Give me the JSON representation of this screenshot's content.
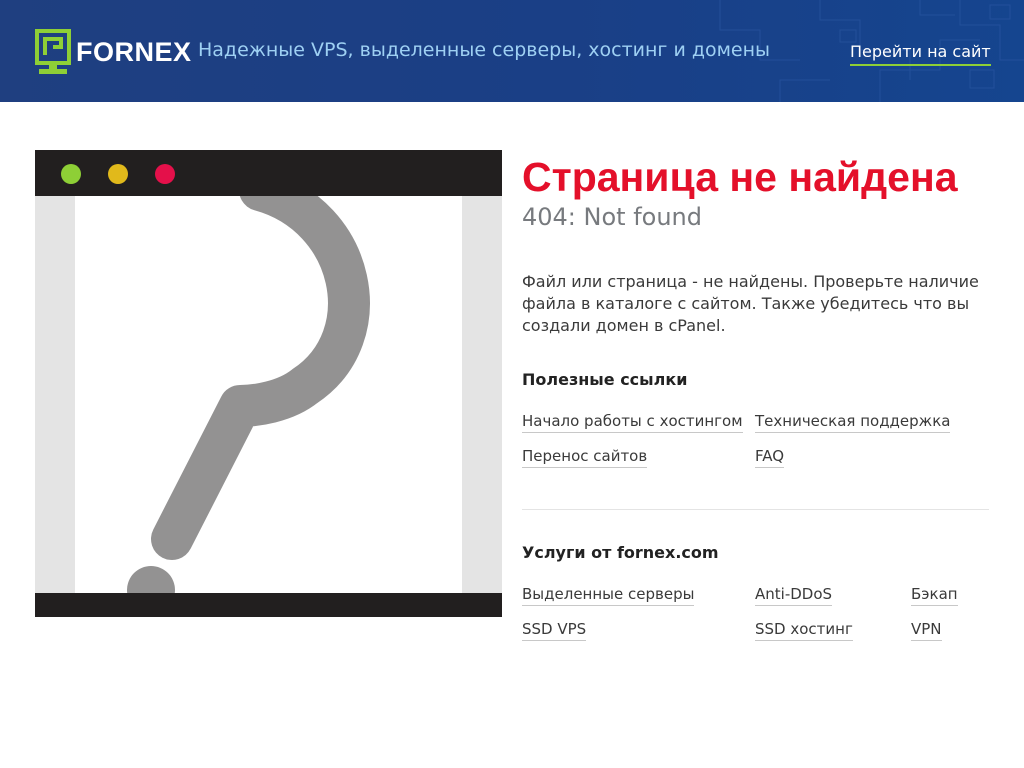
{
  "header": {
    "logo_text": "FORNEX",
    "tagline": "Надежные VPS, выделенные серверы, хостинг и домены",
    "goto_site": "Перейти на сайт"
  },
  "main": {
    "title": "Страница не найдена",
    "subtitle": "404: Not found",
    "description": "Файл или страница - не найдены. Проверьте наличие файла в каталоге с сайтом. Также убедитесь что вы создали домен в cPanel."
  },
  "useful_links": {
    "title": "Полезные ссылки",
    "items": [
      "Начало работы с хостингом",
      "Техническая поддержка",
      "Перенос сайтов",
      "FAQ"
    ]
  },
  "services": {
    "title": "Услуги от fornex.com",
    "items": [
      "Выделенные серверы",
      "Anti-DDoS",
      "Бэкап",
      "SSD VPS",
      "SSD хостинг",
      "VPN"
    ]
  },
  "colors": {
    "header_bg": "#1a3f86",
    "accent_green": "#8ecf36",
    "title_red": "#e4102a",
    "dot_green": "#8ecf36",
    "dot_yellow": "#e1b91b",
    "dot_red": "#e4104a"
  },
  "icons": {
    "logo": "fornex-logo-icon",
    "illustration": "question-mark-icon"
  }
}
